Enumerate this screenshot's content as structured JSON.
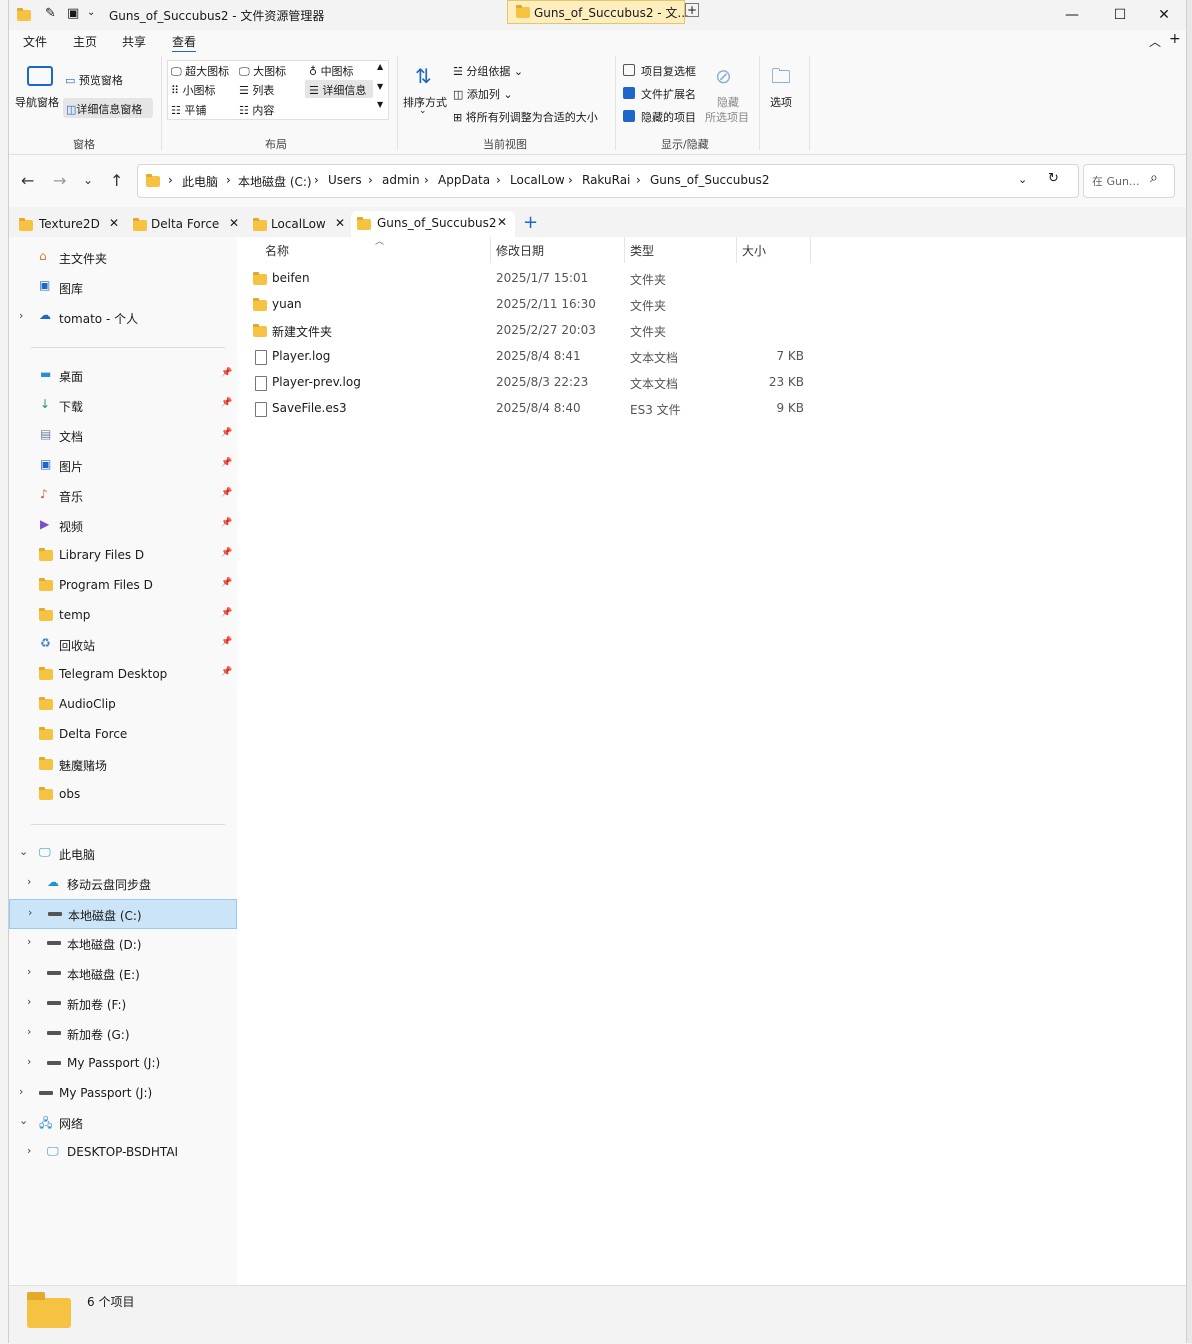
{
  "window": {
    "title": "Guns_of_Succubus2 - 文件资源管理器",
    "other_window_tab": "Guns_of_Succubus2 - 文..."
  },
  "menu": {
    "file": "文件",
    "home": "主页",
    "share": "共享",
    "view": "查看"
  },
  "ribbon": {
    "pane": {
      "nav": "导航窗格",
      "preview": "预览窗格",
      "details": "详细信息窗格",
      "label": "窗格"
    },
    "layout": {
      "extra_large": "超大图标",
      "large": "大图标",
      "medium": "中图标",
      "small": "小图标",
      "list": "列表",
      "details": "详细信息",
      "tiles": "平铺",
      "content": "内容",
      "label": "布局"
    },
    "current_view": {
      "sort": "排序方式",
      "group_by": "分组依据",
      "add_col": "添加列",
      "fit_cols": "将所有列调整为合适的大小",
      "label": "当前视图"
    },
    "show_hide": {
      "item_checkbox": "项目复选框",
      "item_checkbox_checked": false,
      "extensions": "文件扩展名",
      "extensions_checked": true,
      "hidden_items": "隐藏的项目",
      "hidden_items_checked": true,
      "hide_line1": "隐藏",
      "hide_line2": "所选项目",
      "label": "显示/隐藏"
    },
    "options": "选项"
  },
  "address": {
    "crumbs": [
      "此电脑",
      "本地磁盘 (C:)",
      "Users",
      "admin",
      "AppData",
      "LocalLow",
      "RakuRai",
      "Guns_of_Succubus2"
    ],
    "search_placeholder": "在 Gun..."
  },
  "tabs": [
    {
      "label": "Texture2D"
    },
    {
      "label": "Delta Force"
    },
    {
      "label": "LocalLow"
    },
    {
      "label": "Guns_of_Succubus2",
      "active": true
    }
  ],
  "sidebar": {
    "quick": [
      {
        "label": "主文件夹",
        "icon": "home-icon"
      },
      {
        "label": "图库",
        "icon": "gallery-icon"
      },
      {
        "label": "tomato - 个人",
        "icon": "cloud-icon"
      }
    ],
    "pinned": [
      {
        "label": "桌面",
        "icon": "desktop-icon"
      },
      {
        "label": "下载",
        "icon": "download-icon"
      },
      {
        "label": "文档",
        "icon": "document-icon"
      },
      {
        "label": "图片",
        "icon": "pictures-icon"
      },
      {
        "label": "音乐",
        "icon": "music-icon"
      },
      {
        "label": "视频",
        "icon": "video-icon"
      },
      {
        "label": "Library Files D",
        "icon": "folder-icon"
      },
      {
        "label": "Program Files D",
        "icon": "folder-icon"
      },
      {
        "label": "temp",
        "icon": "folder-icon"
      },
      {
        "label": "回收站",
        "icon": "recycle-bin-icon"
      },
      {
        "label": "Telegram Desktop",
        "icon": "folder-icon"
      },
      {
        "label": "AudioClip",
        "icon": "folder-icon"
      },
      {
        "label": "Delta Force",
        "icon": "folder-icon"
      },
      {
        "label": "魅魔赌场",
        "icon": "folder-icon"
      },
      {
        "label": "obs",
        "icon": "folder-icon"
      }
    ],
    "tree": [
      {
        "label": "此电脑",
        "icon": "computer-icon"
      },
      {
        "label": "移动云盘同步盘",
        "icon": "cloud-drive-icon"
      },
      {
        "label": "本地磁盘 (C:)",
        "icon": "drive-icon",
        "selected": true
      },
      {
        "label": "本地磁盘 (D:)",
        "icon": "drive-icon"
      },
      {
        "label": "本地磁盘 (E:)",
        "icon": "drive-icon"
      },
      {
        "label": "新加卷 (F:)",
        "icon": "drive-icon"
      },
      {
        "label": "新加卷 (G:)",
        "icon": "drive-icon"
      },
      {
        "label": "My Passport (J:)",
        "icon": "drive-icon"
      },
      {
        "label": "My Passport (J:)",
        "icon": "drive-icon"
      },
      {
        "label": "网络",
        "icon": "network-icon"
      },
      {
        "label": "DESKTOP-BSDHTAI",
        "icon": "computer-icon"
      }
    ]
  },
  "columns": {
    "name": "名称",
    "date": "修改日期",
    "type": "类型",
    "size": "大小"
  },
  "files": [
    {
      "name": "beifen",
      "date": "2025/1/7 15:01",
      "type": "文件夹",
      "size": "",
      "kind": "folder"
    },
    {
      "name": "yuan",
      "date": "2025/2/11 16:30",
      "type": "文件夹",
      "size": "",
      "kind": "folder"
    },
    {
      "name": "新建文件夹",
      "date": "2025/2/27 20:03",
      "type": "文件夹",
      "size": "",
      "kind": "folder"
    },
    {
      "name": "Player.log",
      "date": "2025/8/4 8:41",
      "type": "文本文档",
      "size": "7 KB",
      "kind": "file"
    },
    {
      "name": "Player-prev.log",
      "date": "2025/8/3 22:23",
      "type": "文本文档",
      "size": "23 KB",
      "kind": "file"
    },
    {
      "name": "SaveFile.es3",
      "date": "2025/8/4 8:40",
      "type": "ES3 文件",
      "size": "9 KB",
      "kind": "file"
    }
  ],
  "status": {
    "count": "6 个项目"
  },
  "colors": {
    "accent": "#1e66c9",
    "selection": "#cce4f7",
    "folder": "#f5c242"
  }
}
